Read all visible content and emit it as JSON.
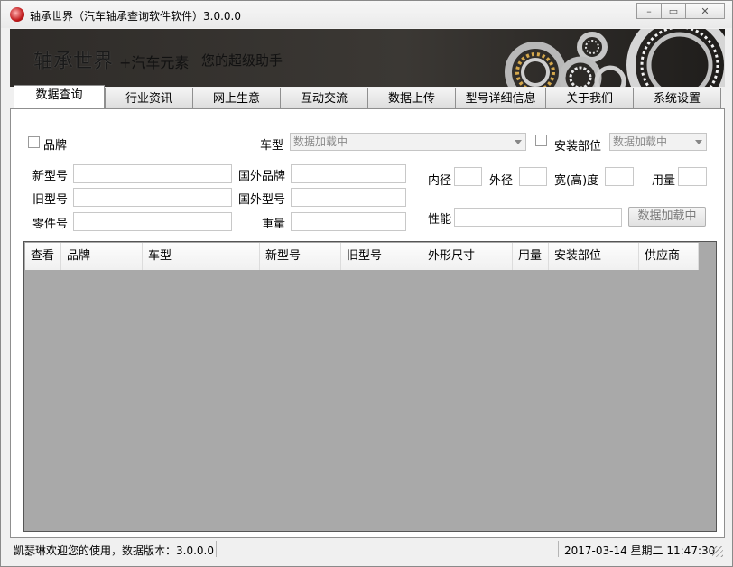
{
  "window": {
    "title": "轴承世界（汽车轴承查询软件软件）3.0.0.0",
    "minimize_icon": "minimize-icon",
    "maximize_icon": "maximize-icon",
    "close_icon": "close-icon"
  },
  "banner": {
    "brand": "轴承世界",
    "slogan1": "+汽车元素",
    "slogan2": "您的超级助手"
  },
  "tabs": [
    "数据查询",
    "行业资讯",
    "网上生意",
    "互动交流",
    "数据上传",
    "型号详细信息",
    "关于我们",
    "系统设置"
  ],
  "form": {
    "brand_label": "品牌",
    "car_model_label": "车型",
    "car_model_select": "数据加载中",
    "install_pos_label": "安装部位",
    "install_pos_select": "数据加载中",
    "new_model_label": "新型号",
    "old_model_label": "旧型号",
    "part_no_label": "零件号",
    "foreign_brand_label": "国外品牌",
    "foreign_model_label": "国外型号",
    "weight_label": "重量",
    "inner_dia_label": "内径",
    "outer_dia_label": "外径",
    "width_label": "宽(高)度",
    "usage_label": "用量",
    "performance_label": "性能",
    "loading_button": "数据加载中"
  },
  "grid": {
    "columns": [
      "查看",
      "品牌",
      "车型",
      "新型号",
      "旧型号",
      "外形尺寸",
      "用量",
      "安装部位",
      "供应商"
    ]
  },
  "status": {
    "left": "凯瑟琳欢迎您的使用，数据版本：3.0.0.0",
    "right": "2017-03-14 星期二 11:47:30"
  },
  "colors": {
    "banner_bg": "#2f2c29",
    "grid_bg": "#a9a9a9",
    "app_icon": "#c0181a"
  }
}
